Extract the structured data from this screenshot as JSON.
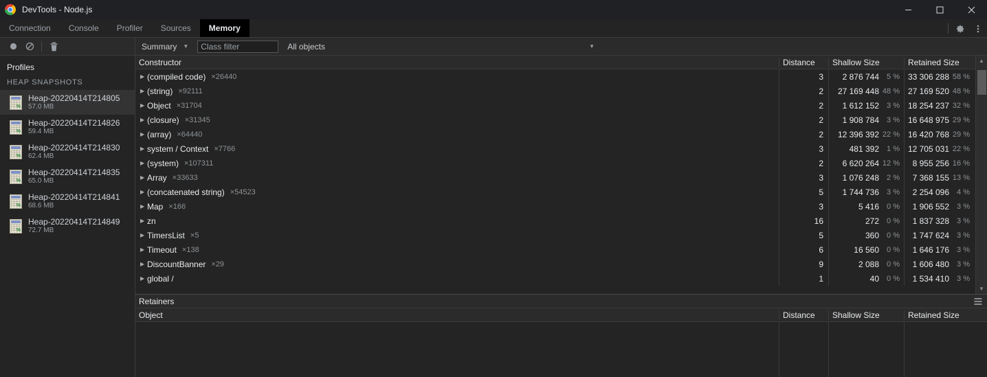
{
  "window": {
    "title": "DevTools - Node.js",
    "logo_icon": "chrome-logo-icon",
    "minimize_icon": "minimize-icon",
    "maximize_icon": "maximize-icon",
    "close_icon": "close-icon"
  },
  "tabs": [
    {
      "label": "Connection",
      "active": false
    },
    {
      "label": "Console",
      "active": false
    },
    {
      "label": "Profiler",
      "active": false
    },
    {
      "label": "Sources",
      "active": false
    },
    {
      "label": "Memory",
      "active": true
    }
  ],
  "tabstrip_actions": {
    "settings_icon": "gear-icon",
    "more_icon": "kebab-menu-icon"
  },
  "toolbar": {
    "record_icon": "record-circle-icon",
    "clear_icon": "no-entry-circle-slash-icon",
    "delete_icon": "trash-icon",
    "view_select": "Summary",
    "view_caret": "▼",
    "class_filter_placeholder": "Class filter",
    "class_filter_value": "",
    "objects_select": "All objects",
    "objects_caret": "▼"
  },
  "sidebar": {
    "title": "Profiles",
    "group_label": "HEAP SNAPSHOTS",
    "profiles": [
      {
        "name": "Heap-20220414T214805",
        "size": "57.0 MB",
        "selected": true
      },
      {
        "name": "Heap-20220414T214826",
        "size": "59.4 MB",
        "selected": false
      },
      {
        "name": "Heap-20220414T214830",
        "size": "62.4 MB",
        "selected": false
      },
      {
        "name": "Heap-20220414T214835",
        "size": "65.0 MB",
        "selected": false
      },
      {
        "name": "Heap-20220414T214841",
        "size": "68.6 MB",
        "selected": false
      },
      {
        "name": "Heap-20220414T214849",
        "size": "72.7 MB",
        "selected": false
      }
    ]
  },
  "grid": {
    "columns": [
      "Constructor",
      "Distance",
      "Shallow Size",
      "Retained Size"
    ],
    "expander_glyph": "▶",
    "rows": [
      {
        "constructor": "(compiled code)",
        "count": "×26440",
        "distance": "3",
        "shallow": "2 876 744",
        "shallow_pct": "5 %",
        "retained": "33 306 288",
        "retained_pct": "58 %"
      },
      {
        "constructor": "(string)",
        "count": "×92111",
        "distance": "2",
        "shallow": "27 169 448",
        "shallow_pct": "48 %",
        "retained": "27 169 520",
        "retained_pct": "48 %"
      },
      {
        "constructor": "Object",
        "count": "×31704",
        "distance": "2",
        "shallow": "1 612 152",
        "shallow_pct": "3 %",
        "retained": "18 254 237",
        "retained_pct": "32 %"
      },
      {
        "constructor": "(closure)",
        "count": "×31345",
        "distance": "2",
        "shallow": "1 908 784",
        "shallow_pct": "3 %",
        "retained": "16 648 975",
        "retained_pct": "29 %"
      },
      {
        "constructor": "(array)",
        "count": "×64440",
        "distance": "2",
        "shallow": "12 396 392",
        "shallow_pct": "22 %",
        "retained": "16 420 768",
        "retained_pct": "29 %"
      },
      {
        "constructor": "system / Context",
        "count": "×7766",
        "distance": "3",
        "shallow": "481 392",
        "shallow_pct": "1 %",
        "retained": "12 705 031",
        "retained_pct": "22 %"
      },
      {
        "constructor": "(system)",
        "count": "×107311",
        "distance": "2",
        "shallow": "6 620 264",
        "shallow_pct": "12 %",
        "retained": "8 955 256",
        "retained_pct": "16 %"
      },
      {
        "constructor": "Array",
        "count": "×33633",
        "distance": "3",
        "shallow": "1 076 248",
        "shallow_pct": "2 %",
        "retained": "7 368 155",
        "retained_pct": "13 %"
      },
      {
        "constructor": "(concatenated string)",
        "count": "×54523",
        "distance": "5",
        "shallow": "1 744 736",
        "shallow_pct": "3 %",
        "retained": "2 254 096",
        "retained_pct": "4 %"
      },
      {
        "constructor": "Map",
        "count": "×166",
        "distance": "3",
        "shallow": "5 416",
        "shallow_pct": "0 %",
        "retained": "1 906 552",
        "retained_pct": "3 %"
      },
      {
        "constructor": "zn",
        "count": "",
        "distance": "16",
        "shallow": "272",
        "shallow_pct": "0 %",
        "retained": "1 837 328",
        "retained_pct": "3 %"
      },
      {
        "constructor": "TimersList",
        "count": "×5",
        "distance": "5",
        "shallow": "360",
        "shallow_pct": "0 %",
        "retained": "1 747 624",
        "retained_pct": "3 %"
      },
      {
        "constructor": "Timeout",
        "count": "×138",
        "distance": "6",
        "shallow": "16 560",
        "shallow_pct": "0 %",
        "retained": "1 646 176",
        "retained_pct": "3 %"
      },
      {
        "constructor": "DiscountBanner",
        "count": "×29",
        "distance": "9",
        "shallow": "2 088",
        "shallow_pct": "0 %",
        "retained": "1 606 480",
        "retained_pct": "3 %"
      },
      {
        "constructor": "global /",
        "count": "",
        "distance": "1",
        "shallow": "40",
        "shallow_pct": "0 %",
        "retained": "1 534 410",
        "retained_pct": "3 %"
      }
    ],
    "scroll_up_glyph": "▲",
    "scroll_down_glyph": "▼"
  },
  "retainers": {
    "title": "Retainers",
    "menu_icon": "hamburger-menu-icon",
    "columns": [
      "Object",
      "Distance",
      "Shallow Size",
      "Retained Size"
    ],
    "rows": []
  }
}
